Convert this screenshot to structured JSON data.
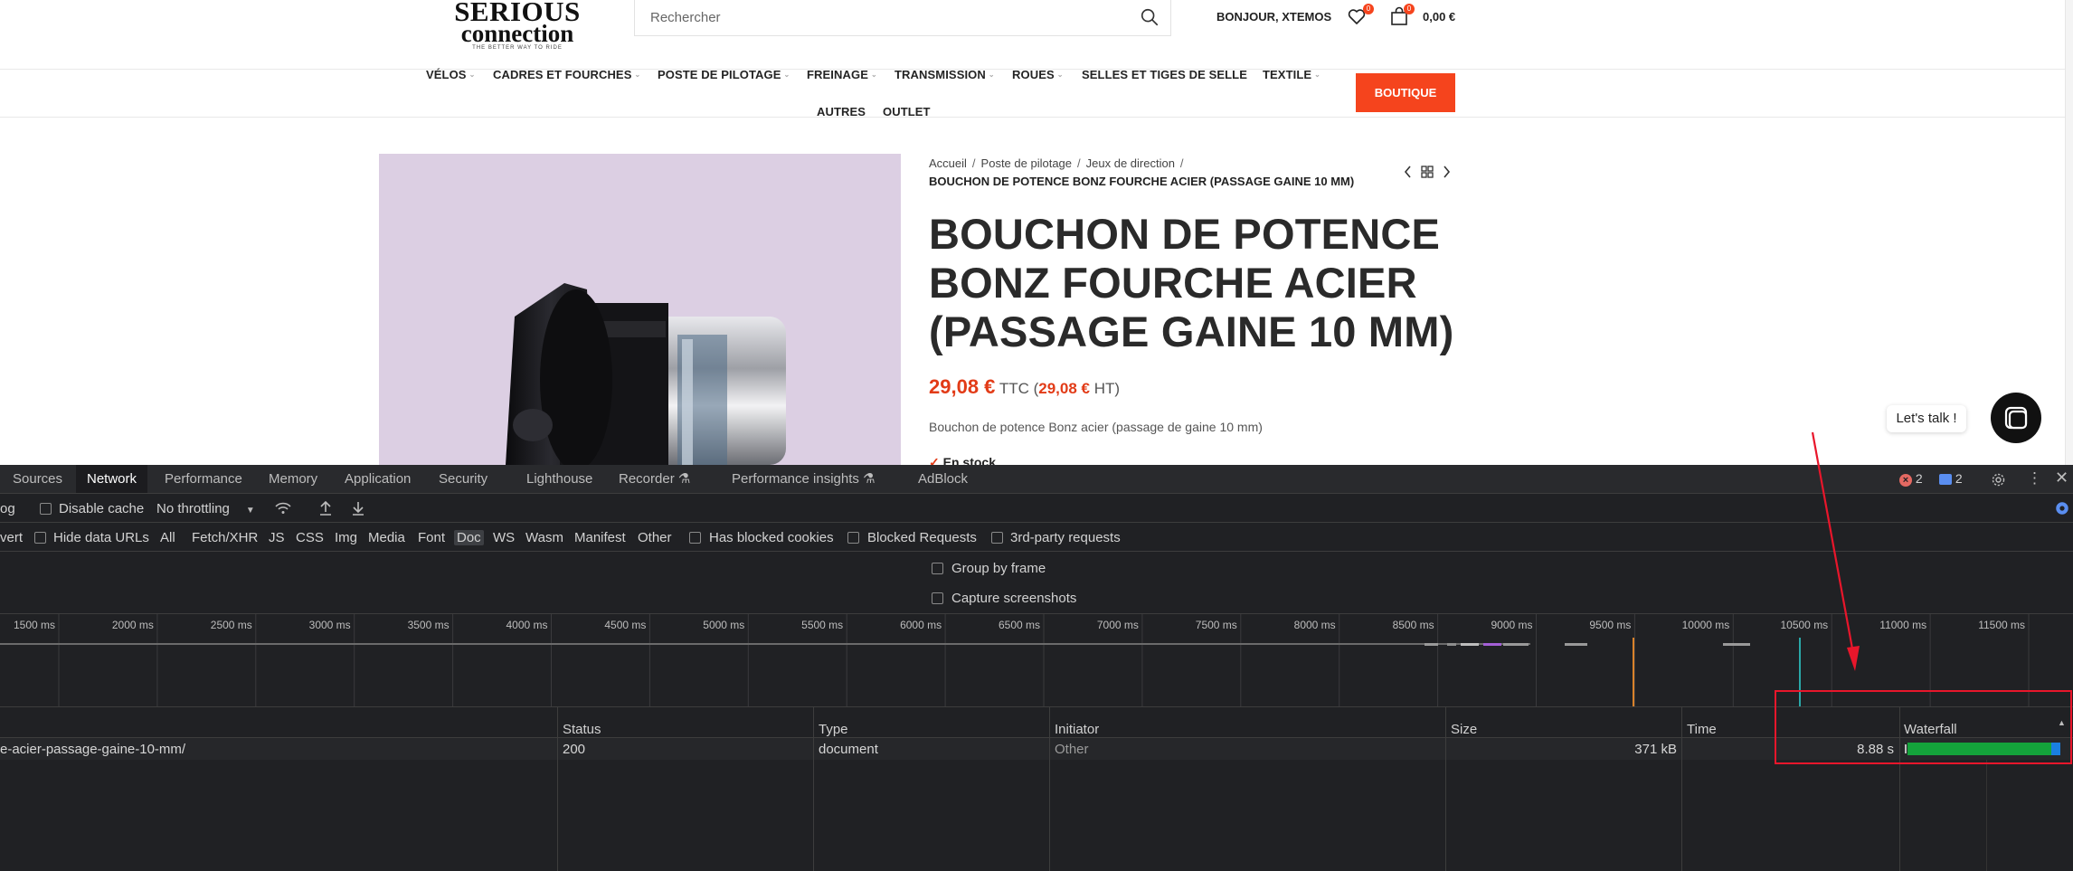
{
  "site": {
    "logo": {
      "line1": "SERIOUS",
      "line2": "connection",
      "tagline": "THE BETTER WAY TO RIDE"
    },
    "search": {
      "placeholder": "Rechercher",
      "icon": "search-icon"
    },
    "greeting": "BONJOUR, XTEMOS",
    "wishlist": {
      "icon": "heart-icon",
      "count": "0"
    },
    "cart": {
      "icon": "bag-icon",
      "count": "0",
      "total": "0,00 €"
    },
    "nav": {
      "items": [
        "VÉLOS",
        "CADRES ET FOURCHES",
        "POSTE DE PILOTAGE",
        "FREINAGE",
        "TRANSMISSION",
        "ROUES",
        "SELLES ET TIGES DE SELLE",
        "TEXTILE"
      ],
      "row2": [
        "AUTRES",
        "OUTLET"
      ],
      "cta": "BOUTIQUE"
    },
    "breadcrumbs": [
      "Accueil",
      "Poste de pilotage",
      "Jeux de direction"
    ],
    "breadcrumb_sep": "/",
    "breadcrumb_current": "BOUCHON DE POTENCE BONZ FOURCHE ACIER (PASSAGE GAINE 10 MM)",
    "product": {
      "title": "BOUCHON DE POTENCE BONZ FOURCHE ACIER (PASSAGE GAINE 10 MM)",
      "price_ttc": "29,08 €",
      "ttc_label": "TTC (",
      "price_ht": "29,08 €",
      "ht_label": "HT)",
      "description": "Bouchon de potence Bonz acier (passage de gaine 10 mm)",
      "stock": "En stock"
    },
    "chat": {
      "label": "Let's talk !",
      "icon": "chat-icon"
    },
    "colors": {
      "accent": "#f5441d",
      "price": "#e23b17"
    }
  },
  "devtools": {
    "tabs": [
      "Sources",
      "Network",
      "Performance",
      "Memory",
      "Application",
      "Security",
      "Lighthouse",
      "Recorder",
      "Performance insights",
      "AdBlock"
    ],
    "active_tab": "Network",
    "errors": "2",
    "messages": "2",
    "toolbar": {
      "preserve_log_fragment": "og",
      "disable_cache": "Disable cache",
      "throttling": "No throttling"
    },
    "filters": {
      "invert_fragment": "vert",
      "hide_data_urls": "Hide data URLs",
      "types": [
        "All",
        "Fetch/XHR",
        "JS",
        "CSS",
        "Img",
        "Media",
        "Font",
        "Doc",
        "WS",
        "Wasm",
        "Manifest",
        "Other"
      ],
      "selected_type": "Doc",
      "blocked_cookies": "Has blocked cookies",
      "blocked_requests": "Blocked Requests",
      "third_party": "3rd-party requests"
    },
    "options": {
      "group_by_frame": "Group by frame",
      "capture_screenshots": "Capture screenshots"
    },
    "timeline_ticks": [
      "1500 ms",
      "2000 ms",
      "2500 ms",
      "3000 ms",
      "3500 ms",
      "4000 ms",
      "4500 ms",
      "5000 ms",
      "5500 ms",
      "6000 ms",
      "6500 ms",
      "7000 ms",
      "7500 ms",
      "8000 ms",
      "8500 ms",
      "9000 ms",
      "9500 ms",
      "10000 ms",
      "10500 ms",
      "11000 ms",
      "11500 ms"
    ],
    "table": {
      "columns": [
        "Status",
        "Type",
        "Initiator",
        "Size",
        "Time",
        "Waterfall"
      ],
      "rows": [
        {
          "name": "e-acier-passage-gaine-10-mm/",
          "status": "200",
          "type": "document",
          "initiator": "Other",
          "size": "371 kB",
          "time": "8.88 s",
          "waterfall_fraction": 1.0
        }
      ]
    }
  }
}
